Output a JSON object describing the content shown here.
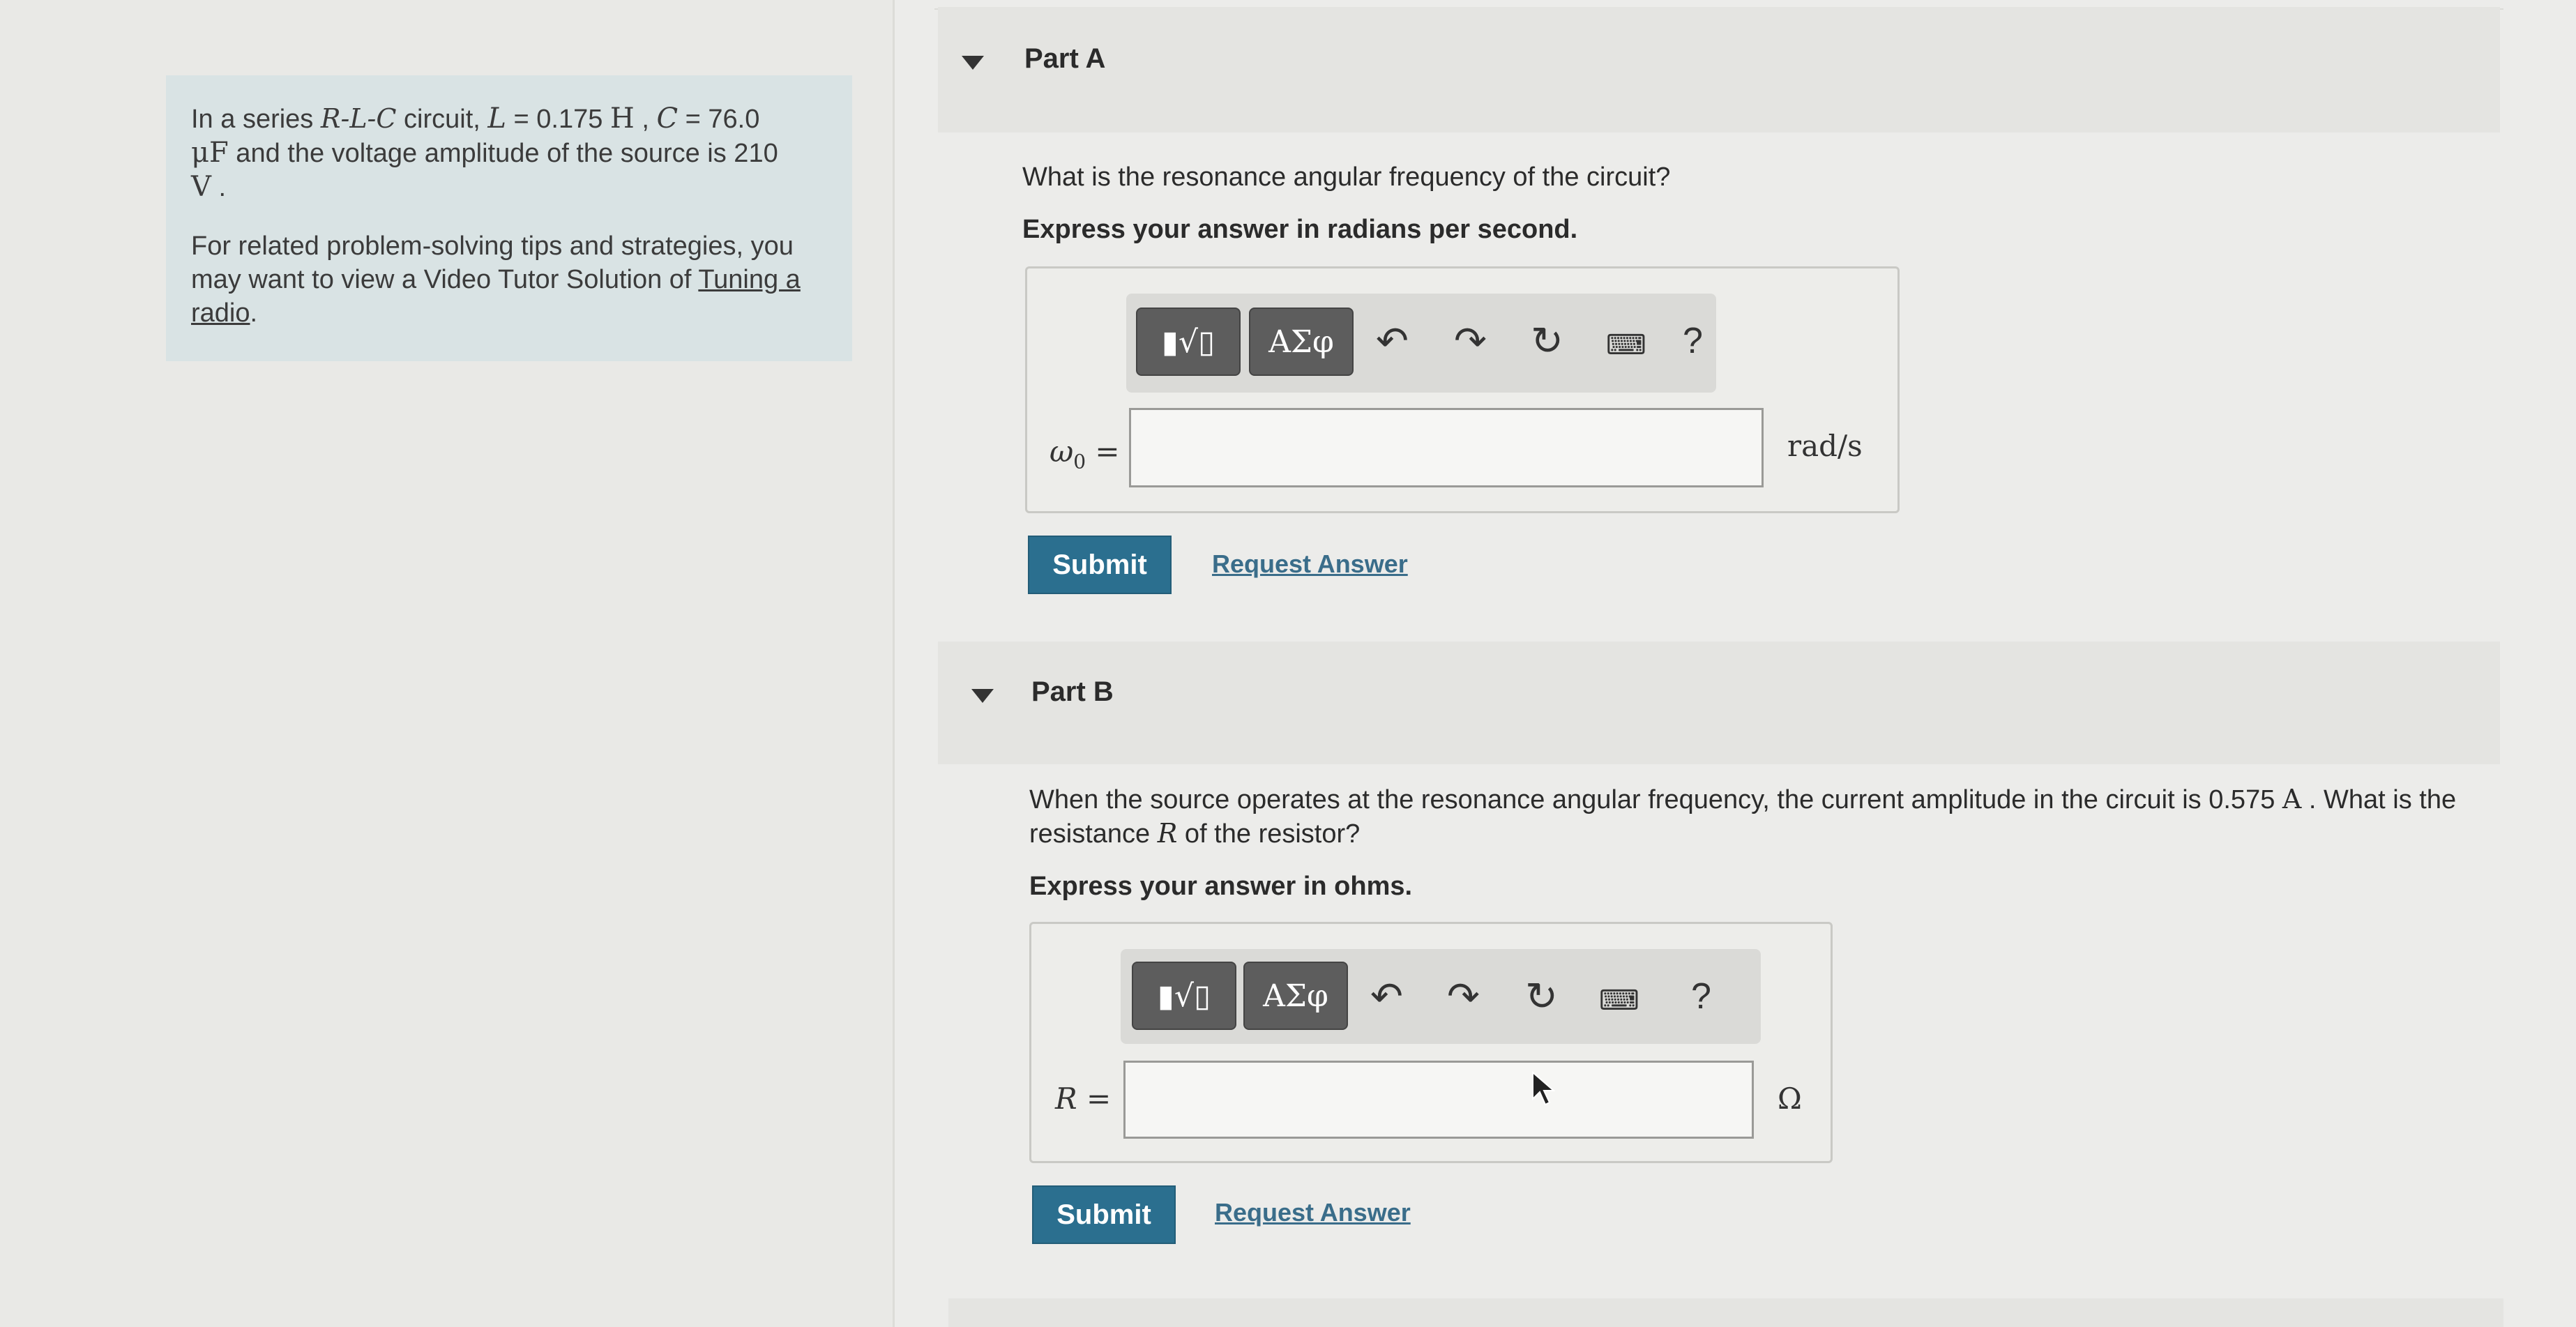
{
  "intro": {
    "line1_pre": "In a series ",
    "circuit_type": "R-L-C",
    "line1_mid": " circuit, ",
    "L_sym": "L",
    "L_val": " = 0.175 ",
    "L_unit": "H",
    "sep": " , ",
    "C_sym": "C",
    "C_val": " = 76.0",
    "C_unit": "μF",
    "line2": " and the voltage amplitude of the source is 210",
    "V_unit": "V",
    "period": " .",
    "tips": "For related problem-solving tips and strategies, you may want to view a Video Tutor Solution of ",
    "tips_link": "Tuning a radio",
    "tips_end": "."
  },
  "partA": {
    "title": "Part A",
    "question": "What is the resonance angular frequency of the circuit?",
    "instruction": "Express your answer in radians per second.",
    "toolbar": {
      "templates": "▮√▯",
      "greek": "ΑΣφ",
      "undo": "↶",
      "redo": "↷",
      "reset": "↻",
      "keyboard": "⌨",
      "help": "?"
    },
    "label_sym": "ω",
    "label_sub": "0",
    "label_eq": " =",
    "input_value": "",
    "unit": "rad/s",
    "submit": "Submit",
    "request": "Request Answer"
  },
  "partB": {
    "title": "Part B",
    "question_pre": "When the source operates at the resonance angular frequency, the current amplitude in the circuit is 0.575 ",
    "A_unit": "A",
    "question_mid": " . What is the resistance ",
    "R_sym": "R",
    "question_end": " of the resistor?",
    "instruction": "Express your answer in ohms.",
    "toolbar": {
      "templates": "▮√▯",
      "greek": "ΑΣφ",
      "undo": "↶",
      "redo": "↷",
      "reset": "↻",
      "keyboard": "⌨",
      "help": "?"
    },
    "label_sym": "R",
    "label_eq": " =",
    "input_value": "",
    "unit": "Ω",
    "submit": "Submit",
    "request": "Request Answer"
  }
}
